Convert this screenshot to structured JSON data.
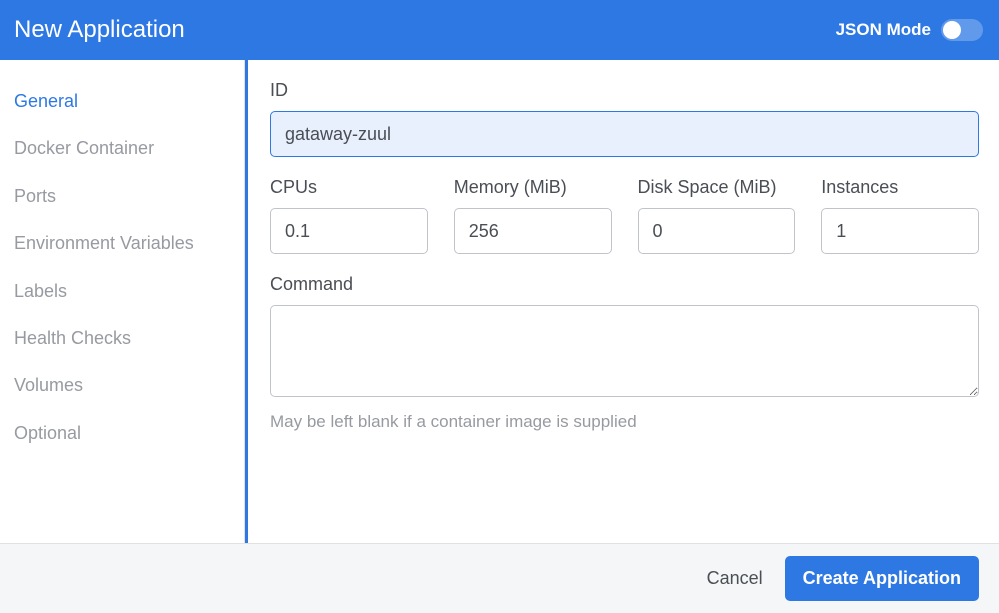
{
  "header": {
    "title": "New Application",
    "json_mode_label": "JSON Mode"
  },
  "sidebar": {
    "items": [
      {
        "label": "General",
        "active": true
      },
      {
        "label": "Docker Container",
        "active": false
      },
      {
        "label": "Ports",
        "active": false
      },
      {
        "label": "Environment Variables",
        "active": false
      },
      {
        "label": "Labels",
        "active": false
      },
      {
        "label": "Health Checks",
        "active": false
      },
      {
        "label": "Volumes",
        "active": false
      },
      {
        "label": "Optional",
        "active": false
      }
    ]
  },
  "form": {
    "id_label": "ID",
    "id_value": "gataway-zuul",
    "cpus_label": "CPUs",
    "cpus_value": "0.1",
    "memory_label": "Memory (MiB)",
    "memory_value": "256",
    "disk_label": "Disk Space (MiB)",
    "disk_value": "0",
    "instances_label": "Instances",
    "instances_value": "1",
    "command_label": "Command",
    "command_value": "",
    "command_hint": "May be left blank if a container image is supplied"
  },
  "footer": {
    "cancel_label": "Cancel",
    "create_label": "Create Application"
  }
}
